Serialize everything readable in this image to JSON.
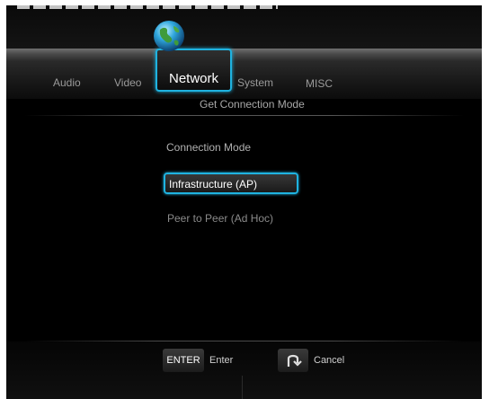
{
  "nav": {
    "tabs": [
      "Audio",
      "Video",
      "Network",
      "System",
      "MISC"
    ],
    "active_tab": "Network",
    "active_icon": "globe-icon"
  },
  "page": {
    "subtitle": "Get Connection Mode",
    "section_label": "Connection Mode"
  },
  "options": [
    {
      "label": "Infrastructure (AP)",
      "selected": true
    },
    {
      "label": "Peer to Peer (Ad Hoc)",
      "selected": false
    }
  ],
  "footer": {
    "enter_key": "ENTER",
    "enter_label": "Enter",
    "cancel_icon": "return-arrow-icon",
    "cancel_label": "Cancel"
  },
  "colors": {
    "accent": "#1fb3e0",
    "background": "#000000"
  }
}
